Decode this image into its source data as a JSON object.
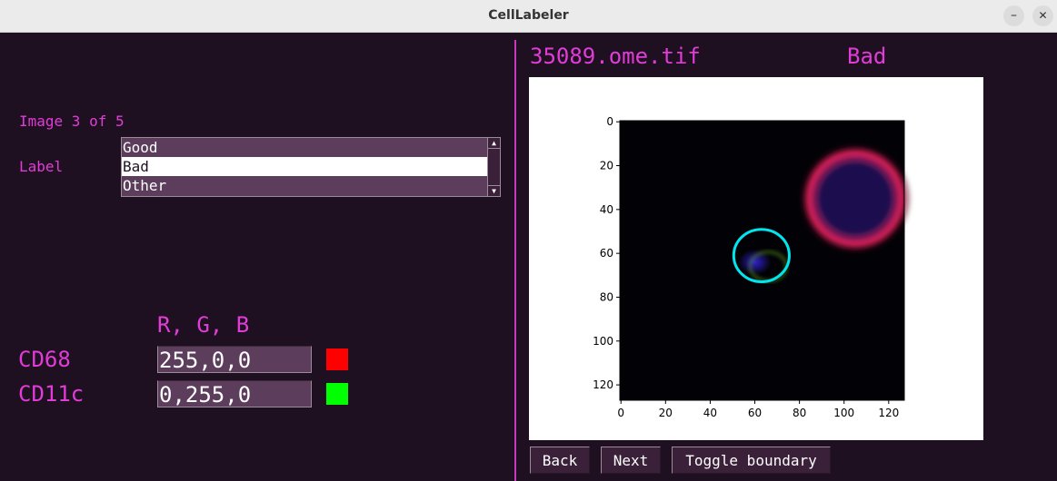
{
  "window": {
    "title": "CellLabeler",
    "minimize_icon": "minimize-icon",
    "close_icon": "close-icon",
    "minimize_glyph": "–",
    "close_glyph": "✕"
  },
  "left": {
    "image_counter": "Image 3 of 5",
    "label_caption": "Label",
    "label_options": [
      "Good",
      "Bad",
      "Other"
    ],
    "selected_label": "Bad",
    "scroll_up_glyph": "▲",
    "scroll_down_glyph": "▼",
    "rgb_header": "R, G, B",
    "channels": [
      {
        "name": "CD68",
        "rgb": "255,0,0",
        "swatch_color": "#ff0000"
      },
      {
        "name": "CD11c",
        "rgb": "0,255,0",
        "swatch_color": "#00ff00"
      }
    ]
  },
  "right": {
    "filename": "35089.ome.tif",
    "current_label": "Bad",
    "buttons": {
      "back": "Back",
      "next": "Next",
      "toggle": "Toggle boundary"
    }
  },
  "chart_data": {
    "type": "image",
    "title": "",
    "xlabel": "",
    "ylabel": "",
    "xlim": [
      0,
      127
    ],
    "ylim": [
      127,
      0
    ],
    "xticks": [
      0,
      20,
      40,
      60,
      80,
      100,
      120
    ],
    "yticks": [
      0,
      20,
      40,
      60,
      80,
      100,
      120
    ],
    "boundary": {
      "color": "#00e5ee",
      "center": [
        63,
        61
      ],
      "radius_x": 12.5,
      "radius_y": 12
    },
    "features": [
      {
        "kind": "nucleus",
        "color": "#3020c0",
        "center": [
          60,
          64
        ]
      },
      {
        "kind": "cell-membrane",
        "color": "#ff2050",
        "center": [
          105,
          35
        ]
      }
    ]
  }
}
